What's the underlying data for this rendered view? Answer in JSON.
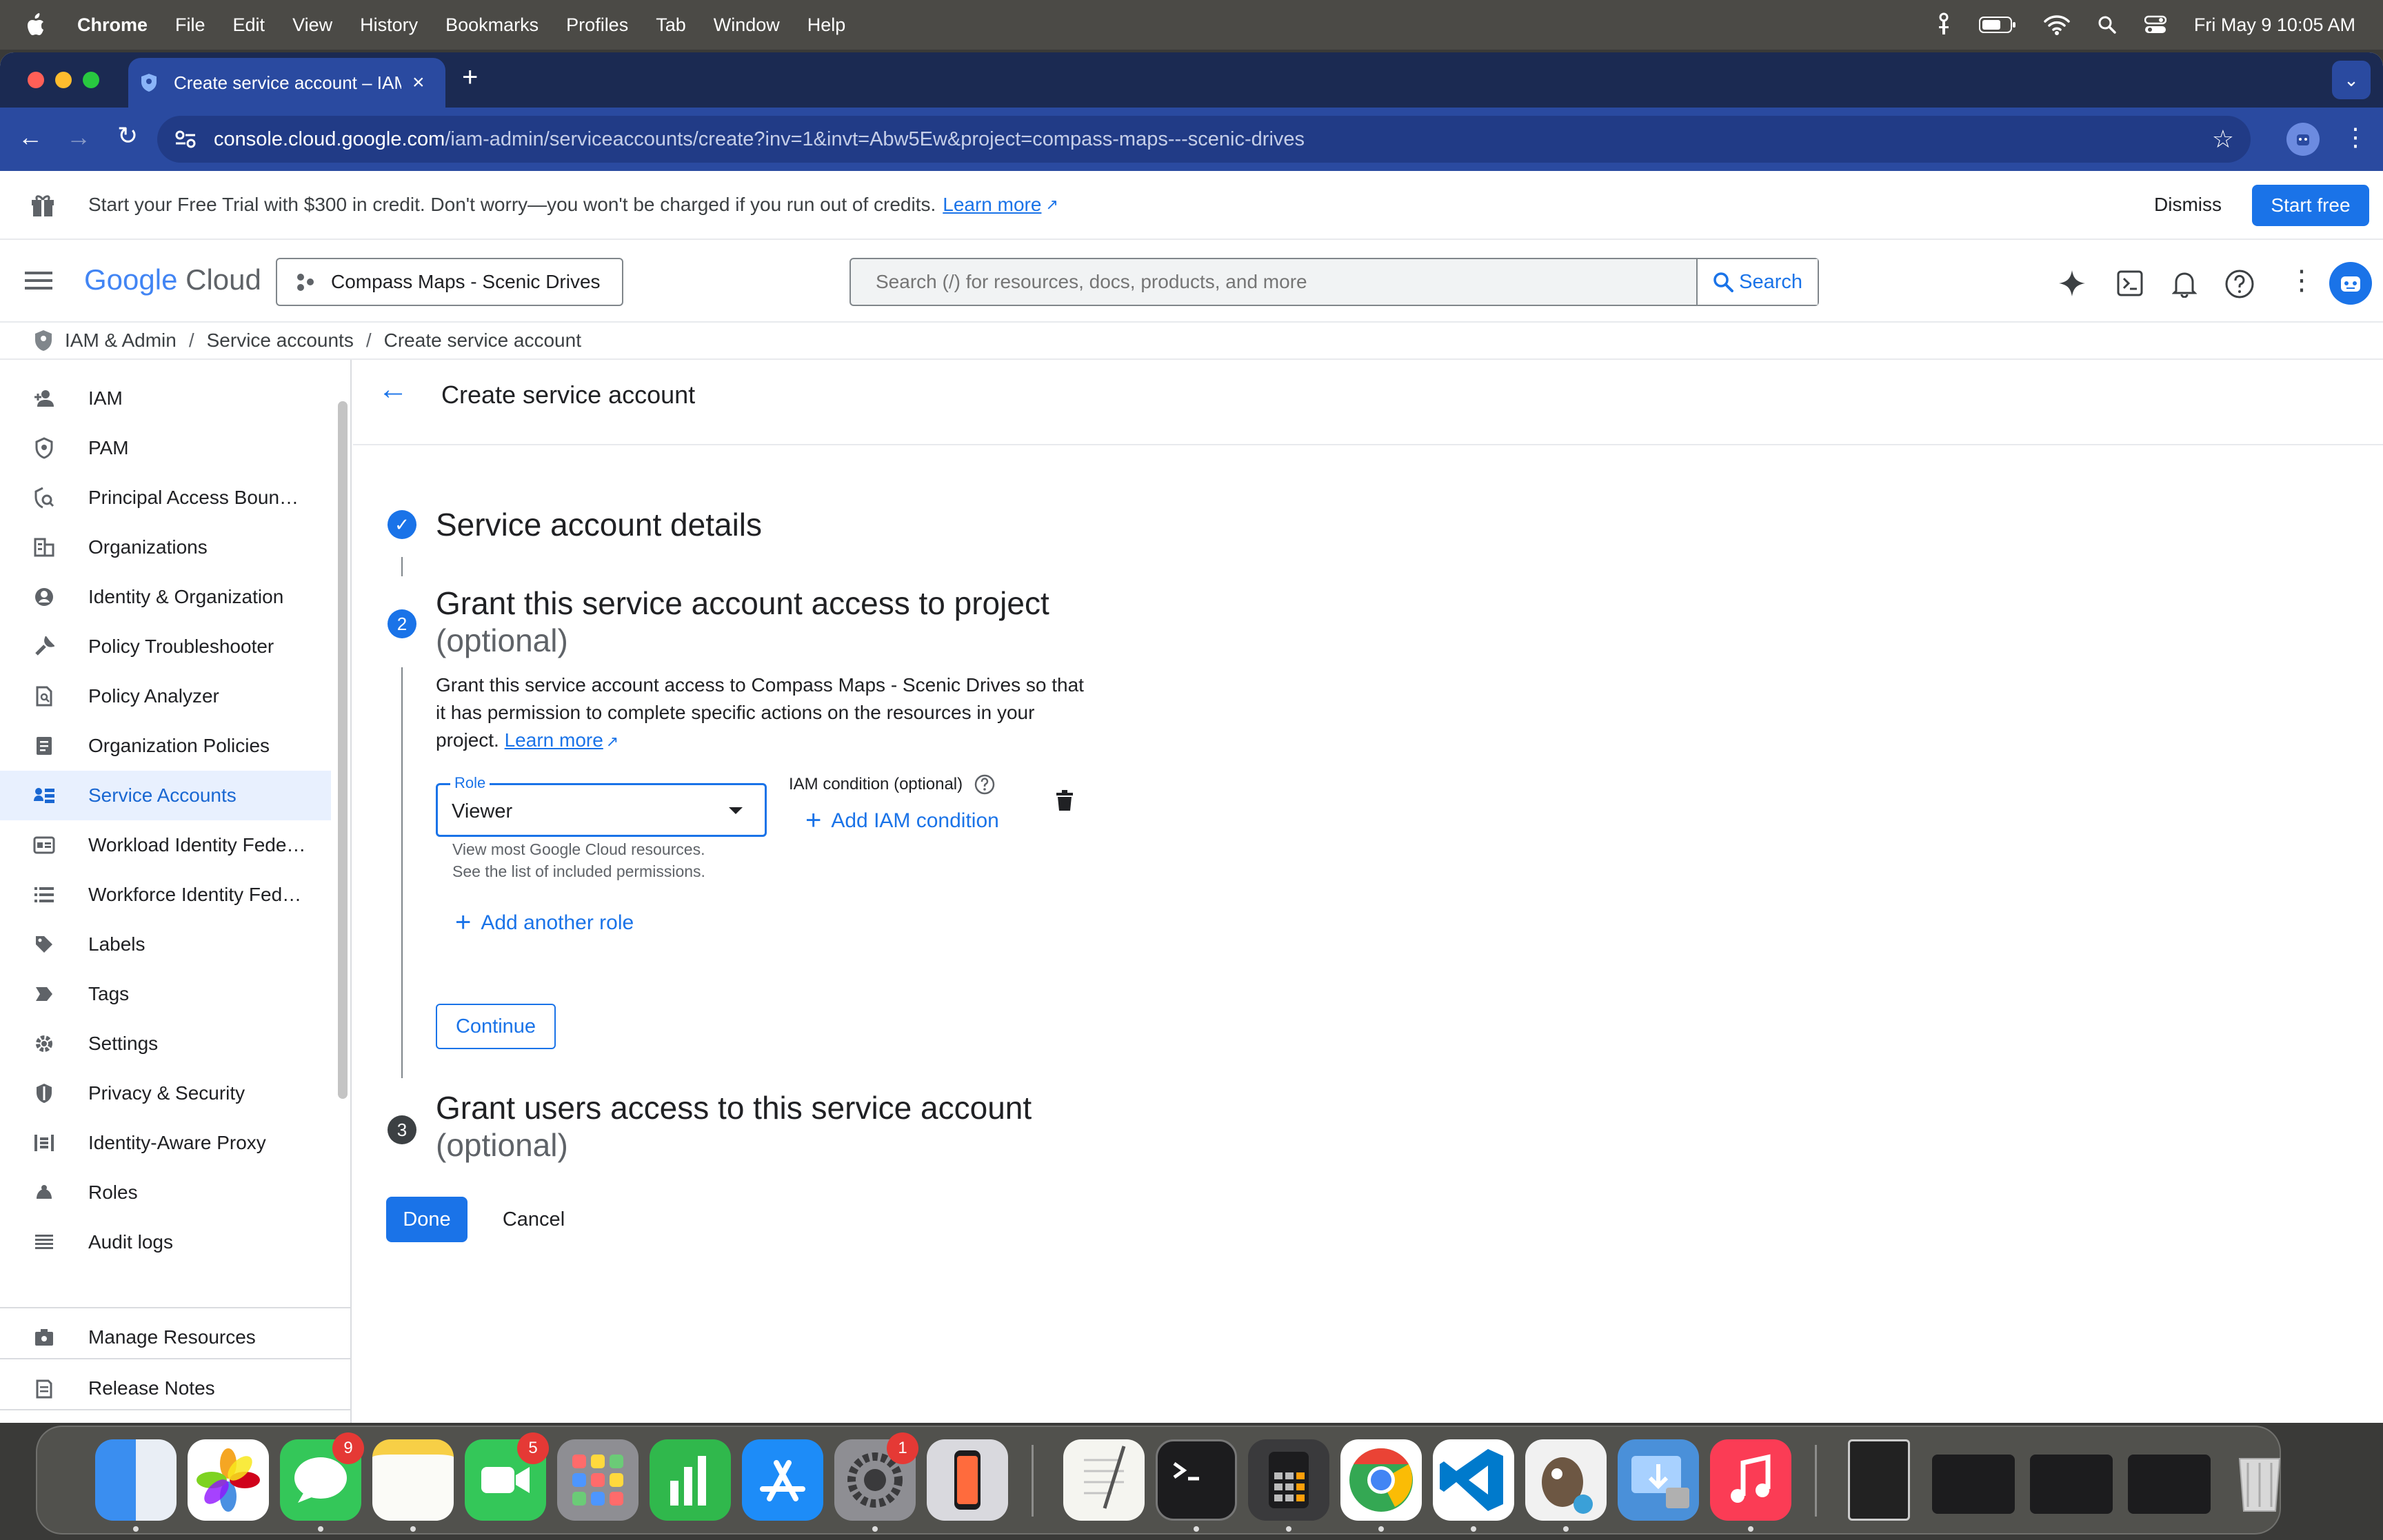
{
  "menubar": {
    "app": "Chrome",
    "items": [
      "File",
      "Edit",
      "View",
      "History",
      "Bookmarks",
      "Profiles",
      "Tab",
      "Window",
      "Help"
    ],
    "datetime": "Fri May 9  10:05 AM"
  },
  "browser": {
    "tab_title": "Create service account – IAM",
    "new_tab": "+",
    "url_domain": "console.cloud.google.com",
    "url_path": "/iam-admin/serviceaccounts/create?inv=1&invt=Abw5Ew&project=compass-maps---scenic-drives"
  },
  "banner": {
    "text": "Start your Free Trial with $300 in credit. Don't worry—you won't be charged if you run out of credits.",
    "learn_more": "Learn more",
    "dismiss": "Dismiss",
    "start_free": "Start free"
  },
  "header": {
    "logo_google": "Google",
    "logo_cloud": "Cloud",
    "project": "Compass Maps - Scenic Drives",
    "search_placeholder": "Search (/) for resources, docs, products, and more",
    "search_button": "Search"
  },
  "breadcrumb": {
    "root": "IAM & Admin",
    "sep": "/",
    "middle": "Service accounts",
    "current": "Create service account"
  },
  "sidebar": {
    "items": [
      {
        "label": "IAM",
        "icon": "person-add-icon"
      },
      {
        "label": "PAM",
        "icon": "shield-icon"
      },
      {
        "label": "Principal Access Boun…",
        "icon": "shield-search-icon"
      },
      {
        "label": "Organizations",
        "icon": "building-icon"
      },
      {
        "label": "Identity & Organization",
        "icon": "account-circle-icon"
      },
      {
        "label": "Policy Troubleshooter",
        "icon": "wrench-icon"
      },
      {
        "label": "Policy Analyzer",
        "icon": "document-search-icon"
      },
      {
        "label": "Organization Policies",
        "icon": "list-document-icon"
      },
      {
        "label": "Service Accounts",
        "icon": "service-account-icon"
      },
      {
        "label": "Workload Identity Fede…",
        "icon": "id-card-icon"
      },
      {
        "label": "Workforce Identity Fed…",
        "icon": "list-icon"
      },
      {
        "label": "Labels",
        "icon": "label-icon"
      },
      {
        "label": "Tags",
        "icon": "tag-icon"
      },
      {
        "label": "Settings",
        "icon": "gear-icon"
      },
      {
        "label": "Privacy & Security",
        "icon": "privacy-shield-icon"
      },
      {
        "label": "Identity-Aware Proxy",
        "icon": "proxy-icon"
      },
      {
        "label": "Roles",
        "icon": "roles-icon"
      },
      {
        "label": "Audit logs",
        "icon": "audit-lines-icon"
      }
    ],
    "bottom_items": [
      {
        "label": "Manage Resources",
        "icon": "manage-resources-icon"
      },
      {
        "label": "Release Notes",
        "icon": "release-notes-icon"
      }
    ],
    "collapse": "<|"
  },
  "page": {
    "title": "Create service account",
    "step1": {
      "title": "Service account details"
    },
    "step2": {
      "number": "2",
      "title": "Grant this service account access to project",
      "optional": "(optional)",
      "desc_line1": "Grant this service account access to Compass Maps - Scenic Drives so that",
      "desc_line2": "it has permission to complete specific actions on the resources in your",
      "desc_line3": "project.",
      "learn_more": "Learn more",
      "role_label": "Role",
      "role_value": "Viewer",
      "role_help1": "View most Google Cloud resources.",
      "role_help2": "See the list of included permissions.",
      "iam_condition_label": "IAM condition (optional)",
      "add_iam_condition": "Add IAM condition",
      "add_another_role": "Add another role",
      "continue": "Continue"
    },
    "step3": {
      "number": "3",
      "title": "Grant users access to this service account",
      "optional": "(optional)"
    },
    "done": "Done",
    "cancel": "Cancel"
  },
  "dock": {
    "apps": [
      "Finder",
      "Photos",
      "Messages",
      "Notes",
      "FaceTime",
      "Launchpad",
      "Numbers",
      "App Store",
      "System Settings",
      "iPhone Mirroring",
      "TextEdit",
      "Terminal",
      "Calculator",
      "Chrome",
      "VS Code",
      "GIMP",
      "Migration Assistant",
      "Music",
      "Preview",
      "Window",
      "Window",
      "Window",
      "Trash"
    ],
    "badges": {
      "messages": "9",
      "facetime": "5",
      "settings": "1"
    }
  },
  "colors": {
    "accent": "#1a73e8",
    "active_bg": "#e8f0fe",
    "tab_strip": "#1b2a52",
    "address_bar": "#2a4aa0"
  }
}
